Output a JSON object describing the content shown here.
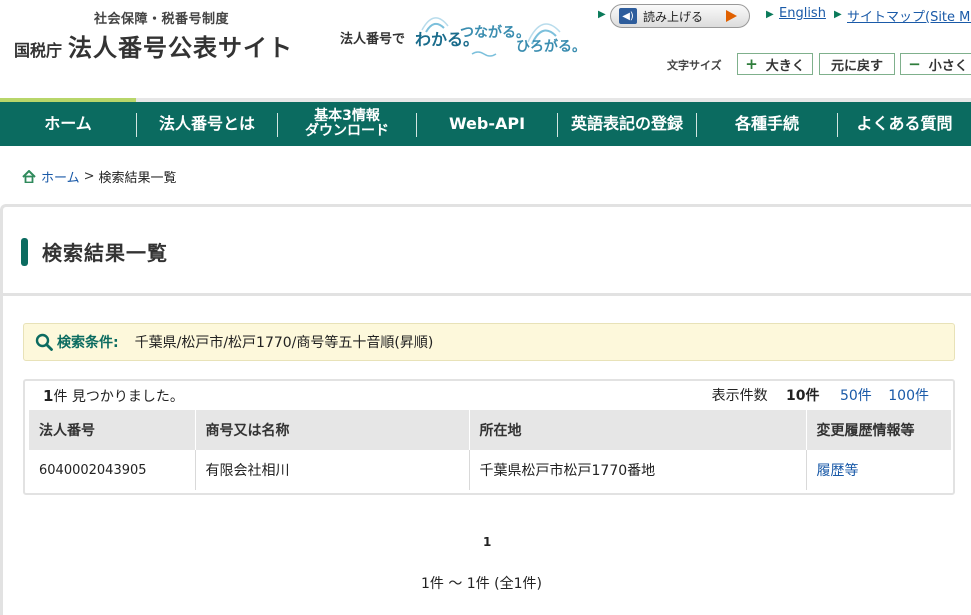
{
  "header": {
    "logo_top": "社会保障・税番号制度",
    "logo_agency": "国税庁",
    "logo_site": "法人番号公表サイト",
    "tagline": {
      "prefix": "法人番号で",
      "a": "わかる。",
      "b": "つながる。",
      "c": "ひろがる。"
    },
    "read_aloud": "読み上げる",
    "english": "English",
    "sitemap": "サイトマップ(Site Map",
    "font_size_label": "文字サイズ",
    "font_larger": "大きく",
    "font_reset": "元に戻す",
    "font_smaller": "小さく"
  },
  "nav": {
    "items": [
      {
        "label": "ホーム"
      },
      {
        "label": "法人番号とは"
      },
      {
        "label_1": "基本3情報",
        "label_2": "ダウンロード"
      },
      {
        "label": "Web-API"
      },
      {
        "label": "英語表記の登録"
      },
      {
        "label": "各種手続"
      },
      {
        "label": "よくある質問"
      }
    ]
  },
  "breadcrumb": {
    "home": "ホーム",
    "separator": ">",
    "current": "検索結果一覧"
  },
  "page": {
    "title": "検索結果一覧",
    "condition_label": "検索条件:",
    "condition_value": "千葉県/松戸市/松戸1770/商号等五十音順(昇順)",
    "count_number": "1",
    "count_text": "件 見つかりました。",
    "per_page_label": "表示件数",
    "per_page_current": "10件",
    "per_page_50": "50件",
    "per_page_100": "100件"
  },
  "table": {
    "headers": [
      "法人番号",
      "商号又は名称",
      "所在地",
      "変更履歴情報等"
    ],
    "rows": [
      {
        "number": "6040002043905",
        "name": "有限会社相川",
        "address": "千葉県松戸市松戸1770番地",
        "history": "履歴等"
      }
    ]
  },
  "pager": {
    "current_page": "1",
    "range": "1件 ～ 1件 (全1件)"
  },
  "colors": {
    "nav_bg": "#0b6b60",
    "nav_accent": "#b8d66a",
    "condition_bg": "#fdf8db",
    "link": "#1a5aa8"
  }
}
